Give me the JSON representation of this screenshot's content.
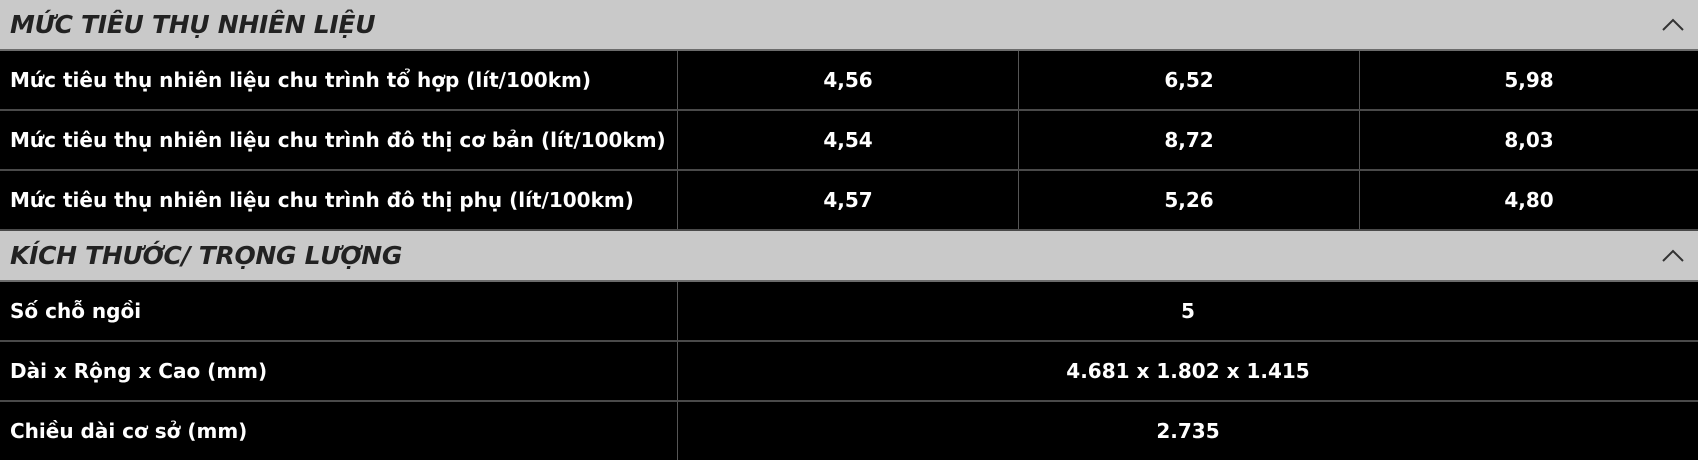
{
  "sections": [
    {
      "title": "MỨC TIÊU THỤ NHIÊN LIỆU",
      "toggle_icon": "chevron-up-icon",
      "rows": [
        {
          "label": "Mức tiêu thụ nhiên liệu chu trình tổ hợp (lít/100km)",
          "values": [
            "4,56",
            "6,52",
            "5,98"
          ]
        },
        {
          "label": "Mức tiêu thụ nhiên liệu chu trình đô thị cơ bản (lít/100km)",
          "values": [
            "4,54",
            "8,72",
            "8,03"
          ]
        },
        {
          "label": "Mức tiêu thụ nhiên liệu chu trình đô thị phụ (lít/100km)",
          "values": [
            "4,57",
            "5,26",
            "4,80"
          ]
        }
      ]
    },
    {
      "title": "KÍCH THƯỚC/ TRỌNG LƯỢNG",
      "toggle_icon": "chevron-up-icon",
      "rows": [
        {
          "label": "Số chỗ ngồi",
          "value": "5"
        },
        {
          "label": "Dài x Rộng x Cao (mm)",
          "value": "4.681 x 1.802 x 1.415"
        },
        {
          "label": "Chiều dài cơ sở (mm)",
          "value": "2.735"
        }
      ]
    }
  ],
  "colors": {
    "header_bg": "#c9c9c9",
    "row_bg": "#000000",
    "text": "#ffffff",
    "divider": "#4a4a4a"
  }
}
